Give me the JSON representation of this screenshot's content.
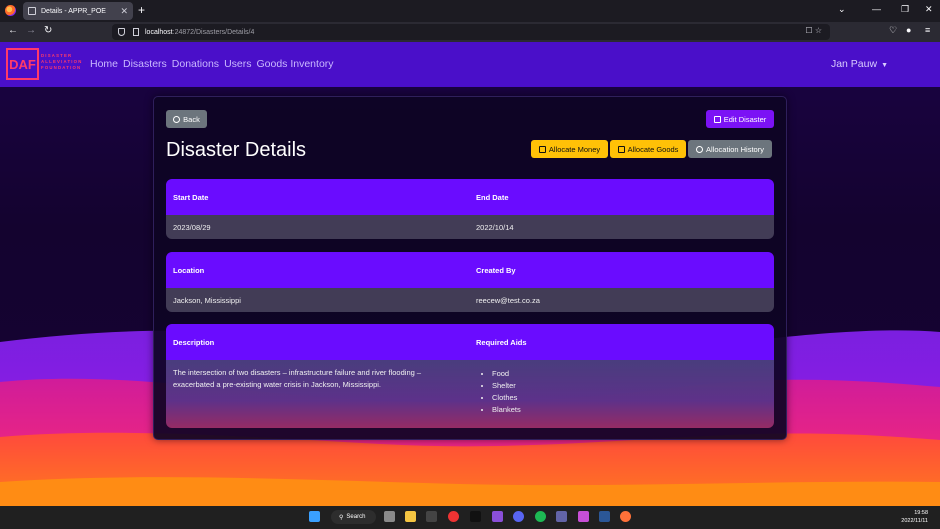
{
  "browser": {
    "tab_title": "Details - APPR_POE",
    "tab_close": "✕",
    "new_tab": "+",
    "url_host": "localhost",
    "url_path": ":24872/Disasters/Details/4",
    "back_glyph": "←",
    "forward_glyph": "→",
    "reload_glyph": "↻",
    "minimize": "⌄",
    "min": "—",
    "restore": "❐",
    "close": "✕",
    "menu": "≡"
  },
  "app": {
    "logo": "DAF",
    "logo_line1": "DISASTER",
    "logo_line2": "ALLEVIATION",
    "logo_line3": "FOUNDATION",
    "nav": [
      "Home",
      "Disasters",
      "Donations",
      "Users",
      "Goods Inventory"
    ],
    "user": "Jan Pauw",
    "accent": "#6a0cff",
    "nav_bg": "#4a0fc9"
  },
  "details": {
    "back_label": "Back",
    "edit_label": "Edit Disaster",
    "title": "Disaster Details",
    "allocate_money": "Allocate Money",
    "allocate_goods": "Allocate Goods",
    "allocation_history": "Allocation History",
    "start_date_label": "Start Date",
    "start_date": "2023/08/29",
    "end_date_label": "End Date",
    "end_date": "2022/10/14",
    "location_label": "Location",
    "location": "Jackson, Mississippi",
    "created_by_label": "Created By",
    "created_by": "reecew@test.co.za",
    "description_label": "Description",
    "description": "The intersection of two disasters – infrastructure failure and river flooding – exacerbated a pre-existing water crisis in Jackson, Mississippi.",
    "required_aids_label": "Required Aids",
    "required_aids": [
      "Food",
      "Shelter",
      "Clothes",
      "Blankets"
    ]
  },
  "taskbar": {
    "search": "Search",
    "time": "19:58",
    "date": "2022/11/11"
  }
}
